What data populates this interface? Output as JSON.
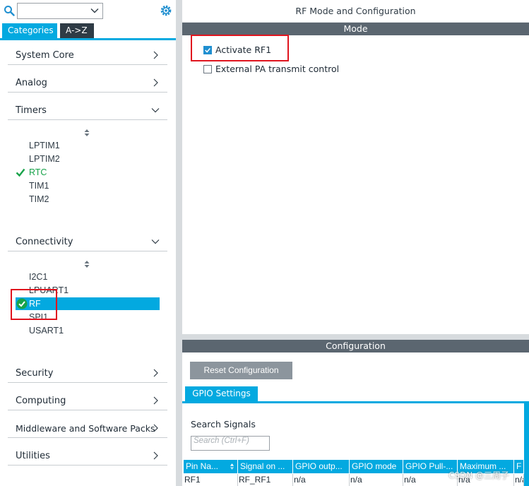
{
  "left": {
    "search": {
      "value": ""
    },
    "tabs": [
      {
        "label": "Categories"
      },
      {
        "label": "A->Z"
      }
    ],
    "categories": {
      "system_core": "System Core",
      "analog": "Analog",
      "timers": "Timers",
      "connectivity": "Connectivity",
      "security": "Security",
      "computing": "Computing",
      "middleware": "Middleware and Software Packs",
      "utilities": "Utilities"
    },
    "timers_items": [
      "LPTIM1",
      "LPTIM2",
      "RTC",
      "TIM1",
      "TIM2"
    ],
    "connectivity_items": [
      "I2C1",
      "LPUART1",
      "RF",
      "SPI1",
      "USART1"
    ]
  },
  "right": {
    "title": "RF Mode and Configuration",
    "mode_band": "Mode",
    "checkboxes": [
      {
        "label": "Activate RF1",
        "checked": true
      },
      {
        "label": "External PA transmit control",
        "checked": false
      }
    ],
    "config_band": "Configuration",
    "reset_button": "Reset Configuration",
    "gpio_tab": "GPIO Settings",
    "search_signals_label": "Search Signals",
    "search_placeholder": "Search (Ctrl+F)",
    "table": {
      "headers": [
        "Pin Na...",
        "Signal on ...",
        "GPIO outp...",
        "GPIO mode",
        "GPIO Pull-...",
        "Maximum ...",
        "F"
      ],
      "rows": [
        [
          "RF1",
          "RF_RF1",
          "n/a",
          "n/a",
          "n/a",
          "n/a",
          "n/a"
        ]
      ]
    }
  },
  "watermark": "CSDN @三周子",
  "colors": {
    "accent": "#03a9e0",
    "band": "#5b6670",
    "dark_tab": "#2f3b45",
    "check_green": "#18a34a",
    "highlight_red": "#e0141e"
  }
}
